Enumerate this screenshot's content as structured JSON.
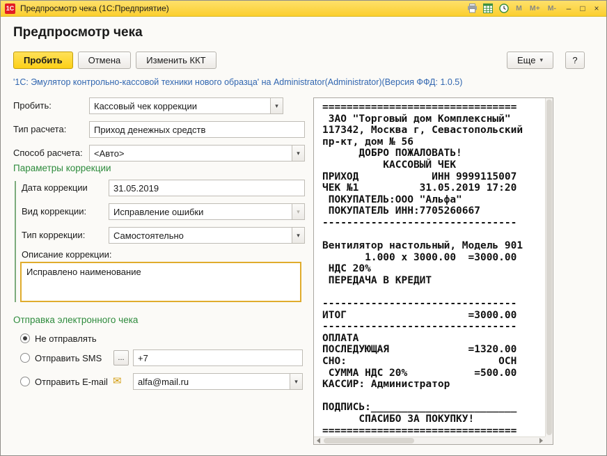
{
  "window": {
    "logo_text": "1С",
    "title": "Предпросмотр чека  (1С:Предприятие)",
    "memory_buttons": {
      "m": "M",
      "m_plus": "M+",
      "m_minus": "M-"
    },
    "controls": {
      "minimize": "–",
      "maximize": "□",
      "close": "×"
    }
  },
  "page": {
    "title": "Предпросмотр чека"
  },
  "toolbar": {
    "commit": "Пробить",
    "cancel": "Отмена",
    "change_kkt": "Изменить ККТ",
    "more": "Еще",
    "help": "?"
  },
  "device_link": "'1С: Эмулятор контрольно-кассовой техники нового образца' на Administrator(Administrator)(Версия ФФД: 1.0.5)",
  "form": {
    "operation": {
      "label": "Пробить:",
      "value": "Кассовый чек коррекции"
    },
    "calc_type": {
      "label": "Тип расчета:",
      "value": "Приход денежных средств"
    },
    "calc_method": {
      "label": "Способ расчета:",
      "value": "<Авто>"
    },
    "correction": {
      "section_title": "Параметры коррекции",
      "date": {
        "label": "Дата коррекции",
        "value": "31.05.2019"
      },
      "kind": {
        "label": "Вид коррекции:",
        "value": "Исправление ошибки"
      },
      "type": {
        "label": "Тип коррекции:",
        "value": "Самостоятельно"
      },
      "description": {
        "label": "Описание коррекции:",
        "value": "Исправлено наименование"
      }
    },
    "send": {
      "section_title": "Отправка электронного чека",
      "sms_more_label": "...",
      "options": [
        {
          "label": "Не отправлять",
          "selected": true
        },
        {
          "label": "Отправить SMS",
          "selected": false,
          "value": "+7"
        },
        {
          "label": "Отправить E-mail",
          "selected": false,
          "value": "alfa@mail.ru"
        }
      ]
    }
  },
  "icons": {
    "caret": "▾",
    "envelope": "✉"
  },
  "receipt": {
    "lines": [
      "================================",
      " ЗАО \"Торговый дом Комплексный\"",
      "117342, Москва г, Севастопольский",
      "пр-кт, дом № 56",
      "      ДОБРО ПОЖАЛОВАТЬ!",
      "          КАССОВЫЙ ЧЕК",
      "ПРИХОД            ИНН 9999115007",
      "ЧЕК №1          31.05.2019 17:20",
      " ПОКУПАТЕЛЬ:ООО \"Альфа\"",
      " ПОКУПАТЕЛЬ ИНН:7705260667",
      "--------------------------------",
      "",
      "Вентилятор настольный, Модель 901",
      "       1.000 x 3000.00  =3000.00",
      " НДС 20%",
      " ПЕРЕДАЧА В КРЕДИТ",
      "",
      "--------------------------------",
      "ИТОГ                    =3000.00",
      "--------------------------------",
      "ОПЛАТА",
      "ПОСЛЕДУЮЩАЯ             =1320.00",
      "СНО:                         ОСН",
      " СУММА НДС 20%           =500.00",
      "КАССИР: Администратор",
      "",
      "ПОДПИСЬ:________________________",
      "      СПАСИБО ЗА ПОКУПКУ!",
      "================================"
    ]
  },
  "colors": {
    "titlebar_yellow": "#fbcf2f",
    "accent_button_yellow": "#fdd017",
    "section_green": "#2e8b3d",
    "link_blue": "#3166b0",
    "focus_border_yellow": "#e0ac2d",
    "logo_red": "#e31e24"
  }
}
